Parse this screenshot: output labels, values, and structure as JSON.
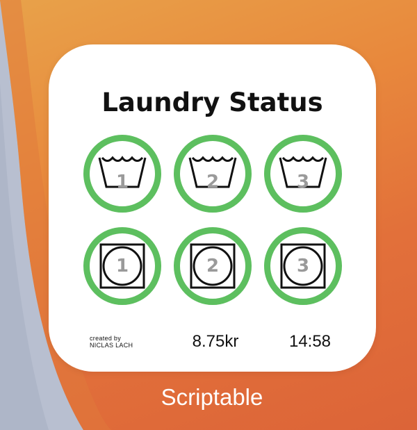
{
  "widget": {
    "title": "Laundry Status",
    "washers": [
      {
        "number": "1",
        "icon": "wash-tub-icon",
        "status_color": "#5dbf5f"
      },
      {
        "number": "2",
        "icon": "wash-tub-icon",
        "status_color": "#5dbf5f"
      },
      {
        "number": "3",
        "icon": "wash-tub-icon",
        "status_color": "#5dbf5f"
      }
    ],
    "dryers": [
      {
        "number": "1",
        "icon": "tumble-dryer-icon",
        "status_color": "#5dbf5f"
      },
      {
        "number": "2",
        "icon": "tumble-dryer-icon",
        "status_color": "#5dbf5f"
      },
      {
        "number": "3",
        "icon": "tumble-dryer-icon",
        "status_color": "#5dbf5f"
      }
    ],
    "credit_line1": "created by",
    "credit_line2": "NICLAS LACH",
    "price": "8.75kr",
    "time": "14:58"
  },
  "app_label": "Scriptable",
  "colors": {
    "available": "#5dbf5f",
    "number": "#9a9a9a",
    "wallpaper": "#e8883c"
  }
}
